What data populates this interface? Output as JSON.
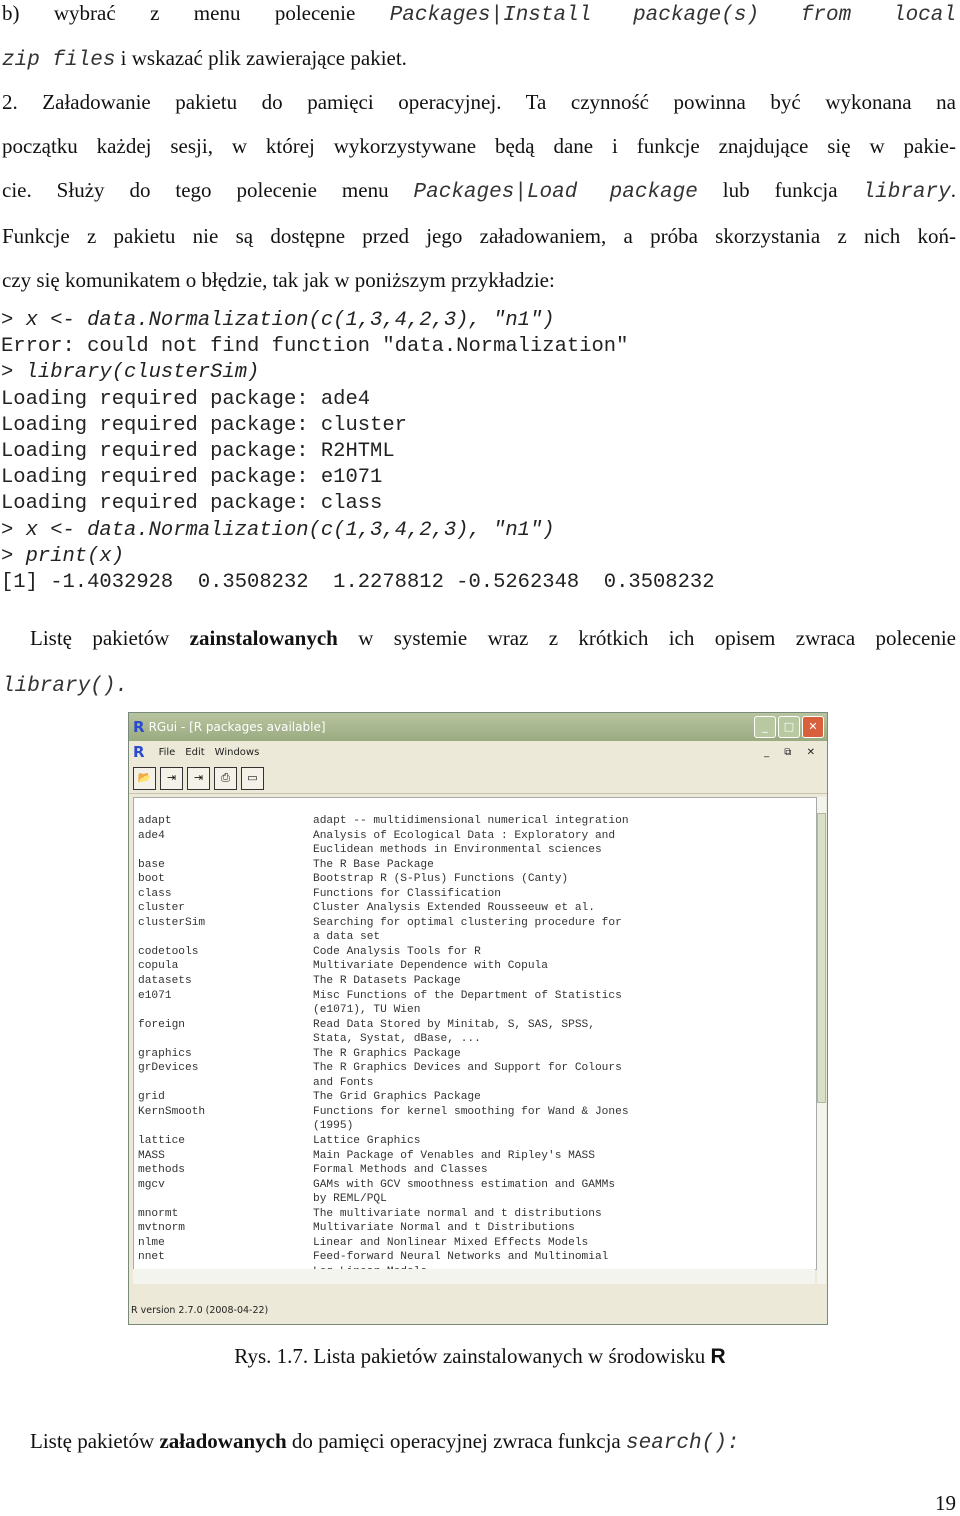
{
  "text": {
    "l1a": "b) wybrać z menu polecenie ",
    "l1b": "Packages|Install package(s) from local",
    "l2a": "zip files",
    "l2b": " i wskazać plik zawierające pakiet.",
    "l3": "2. Załadowanie pakietu do pamięci operacyjnej. Ta czynność powinna być wykonana na",
    "l4": "początku każdej sesji, w której wykorzystywane będą dane i funkcje znajdujące się w pakie-",
    "l5a": "cie. Służy do tego polecenie menu ",
    "l5b": "Packages|Load package",
    "l5c": " lub funkcja ",
    "l5d": "library",
    "l5e": ".",
    "l6": "Funkcje z pakietu nie są dostępne przed jego załadowaniem, a próba skorzystania z nich koń-",
    "l7": "czy się komunikatem o błędzie, tak jak w poniższym przykładzie:",
    "p2a": "Listę pakietów ",
    "p2b": "zainstalowanych",
    "p2c": " w systemie wraz z krótkich ich opisem zwraca polecenie",
    "p2d": "library().",
    "caption_a": "Rys. 1.7. Lista pakietów zainstalowanych w środowisku ",
    "caption_b": "R",
    "p3a": "Listę pakietów ",
    "p3b": "załadowanych",
    "p3c": " do pamięci operacyjnej zwraca funkcja ",
    "p3d": "search():",
    "page_number": "19"
  },
  "code": [
    "> x <- data.Normalization(c(1,3,4,2,3), \"n1\")",
    "Error: could not find function \"data.Normalization\"",
    "> library(clusterSim)",
    "Loading required package: ade4",
    "Loading required package: cluster",
    "Loading required package: R2HTML",
    "Loading required package: e1071",
    "Loading required package: class",
    "> x <- data.Normalization(c(1,3,4,2,3), \"n1\")",
    "> print(x)",
    "[1] -1.4032928  0.3508232  1.2278812 -0.5262348  0.3508232"
  ],
  "window": {
    "title": "RGui - [R packages available]",
    "menu": [
      "File",
      "Edit",
      "Windows"
    ],
    "status": "R version 2.7.0 (2008-04-22)",
    "toolbar_icons": [
      "open-icon",
      "load-workspace-icon",
      "save-workspace-icon",
      "print-icon",
      "console-icon"
    ],
    "packages": [
      [
        "adapt",
        "adapt -- multidimensional numerical integration"
      ],
      [
        "ade4",
        "Analysis of Ecological Data : Exploratory and"
      ],
      [
        "",
        "Euclidean methods in Environmental sciences"
      ],
      [
        "base",
        "The R Base Package"
      ],
      [
        "boot",
        "Bootstrap R (S-Plus) Functions (Canty)"
      ],
      [
        "class",
        "Functions for Classification"
      ],
      [
        "cluster",
        "Cluster Analysis Extended Rousseeuw et al."
      ],
      [
        "clusterSim",
        "Searching for optimal clustering procedure for"
      ],
      [
        "",
        "a data set"
      ],
      [
        "codetools",
        "Code Analysis Tools for R"
      ],
      [
        "copula",
        "Multivariate Dependence with Copula"
      ],
      [
        "datasets",
        "The R Datasets Package"
      ],
      [
        "e1071",
        "Misc Functions of the Department of Statistics"
      ],
      [
        "",
        "(e1071), TU Wien"
      ],
      [
        "foreign",
        "Read Data Stored by Minitab, S, SAS, SPSS,"
      ],
      [
        "",
        "Stata, Systat, dBase, ..."
      ],
      [
        "graphics",
        "The R Graphics Package"
      ],
      [
        "grDevices",
        "The R Graphics Devices and Support for Colours"
      ],
      [
        "",
        "and Fonts"
      ],
      [
        "grid",
        "The Grid Graphics Package"
      ],
      [
        "KernSmooth",
        "Functions for kernel smoothing for Wand & Jones"
      ],
      [
        "",
        "(1995)"
      ],
      [
        "lattice",
        "Lattice Graphics"
      ],
      [
        "MASS",
        "Main Package of Venables and Ripley's MASS"
      ],
      [
        "methods",
        "Formal Methods and Classes"
      ],
      [
        "mgcv",
        "GAMs with GCV smoothness estimation and GAMMs"
      ],
      [
        "",
        "by REML/PQL"
      ],
      [
        "mnormt",
        "The multivariate normal and t distributions"
      ],
      [
        "mvtnorm",
        "Multivariate Normal and t Distributions"
      ],
      [
        "nlme",
        "Linear and Nonlinear Mixed Effects Models"
      ],
      [
        "nnet",
        "Feed-forward Neural Networks and Multinomial"
      ],
      [
        "",
        "Log-Linear Models"
      ]
    ]
  }
}
